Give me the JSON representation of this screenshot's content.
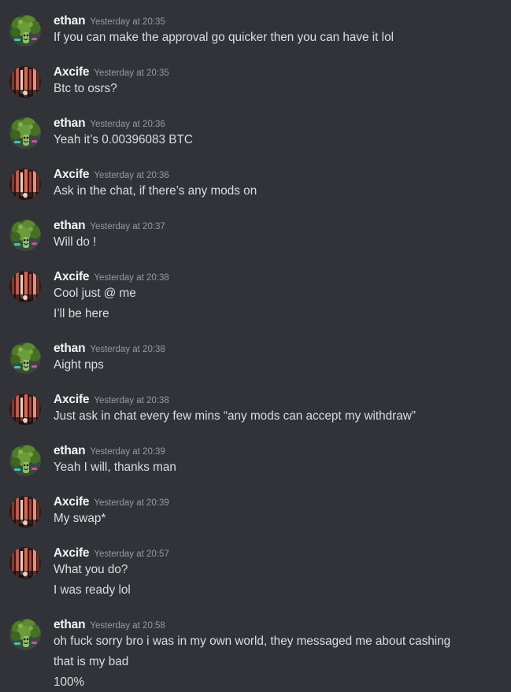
{
  "colors": {
    "background": "#313338",
    "username": "#f2f3f5",
    "timestamp": "#949ba4",
    "text": "#dbdee1"
  },
  "messages": [
    {
      "author": "ethan",
      "avatar_icon": "broccoli-avatar-icon",
      "timestamp": "Yesterday at 20:35",
      "lines": [
        "If you can make the approval go quicker then you can have it lol"
      ]
    },
    {
      "author": "Axcife",
      "avatar_icon": "red-lights-avatar-icon",
      "timestamp": "Yesterday at 20:35",
      "lines": [
        "Btc to osrs?"
      ]
    },
    {
      "author": "ethan",
      "avatar_icon": "broccoli-avatar-icon",
      "timestamp": "Yesterday at 20:36",
      "lines": [
        "Yeah it’s 0.00396083 BTC"
      ]
    },
    {
      "author": "Axcife",
      "avatar_icon": "red-lights-avatar-icon",
      "timestamp": "Yesterday at 20:36",
      "lines": [
        "Ask in the chat, if there’s any mods on"
      ]
    },
    {
      "author": "ethan",
      "avatar_icon": "broccoli-avatar-icon",
      "timestamp": "Yesterday at 20:37",
      "lines": [
        "Will do !"
      ]
    },
    {
      "author": "Axcife",
      "avatar_icon": "red-lights-avatar-icon",
      "timestamp": "Yesterday at 20:38",
      "lines": [
        "Cool just @ me",
        "I’ll be here"
      ]
    },
    {
      "author": "ethan",
      "avatar_icon": "broccoli-avatar-icon",
      "timestamp": "Yesterday at 20:38",
      "lines": [
        "Aight nps"
      ]
    },
    {
      "author": "Axcife",
      "avatar_icon": "red-lights-avatar-icon",
      "timestamp": "Yesterday at 20:38",
      "lines": [
        "Just ask in chat every few mins “any mods can accept my withdraw”"
      ]
    },
    {
      "author": "ethan",
      "avatar_icon": "broccoli-avatar-icon",
      "timestamp": "Yesterday at 20:39",
      "lines": [
        "Yeah I will, thanks man"
      ]
    },
    {
      "author": "Axcife",
      "avatar_icon": "red-lights-avatar-icon",
      "timestamp": "Yesterday at 20:39",
      "lines": [
        "My swap*"
      ]
    },
    {
      "author": "Axcife",
      "avatar_icon": "red-lights-avatar-icon",
      "timestamp": "Yesterday at 20:57",
      "lines": [
        "What you do?",
        "I was ready lol"
      ]
    },
    {
      "author": "ethan",
      "avatar_icon": "broccoli-avatar-icon",
      "timestamp": "Yesterday at 20:58",
      "lines": [
        "oh fuck sorry bro i was in my own world, they messaged me about cashing",
        "that is my bad",
        "100%"
      ]
    }
  ]
}
